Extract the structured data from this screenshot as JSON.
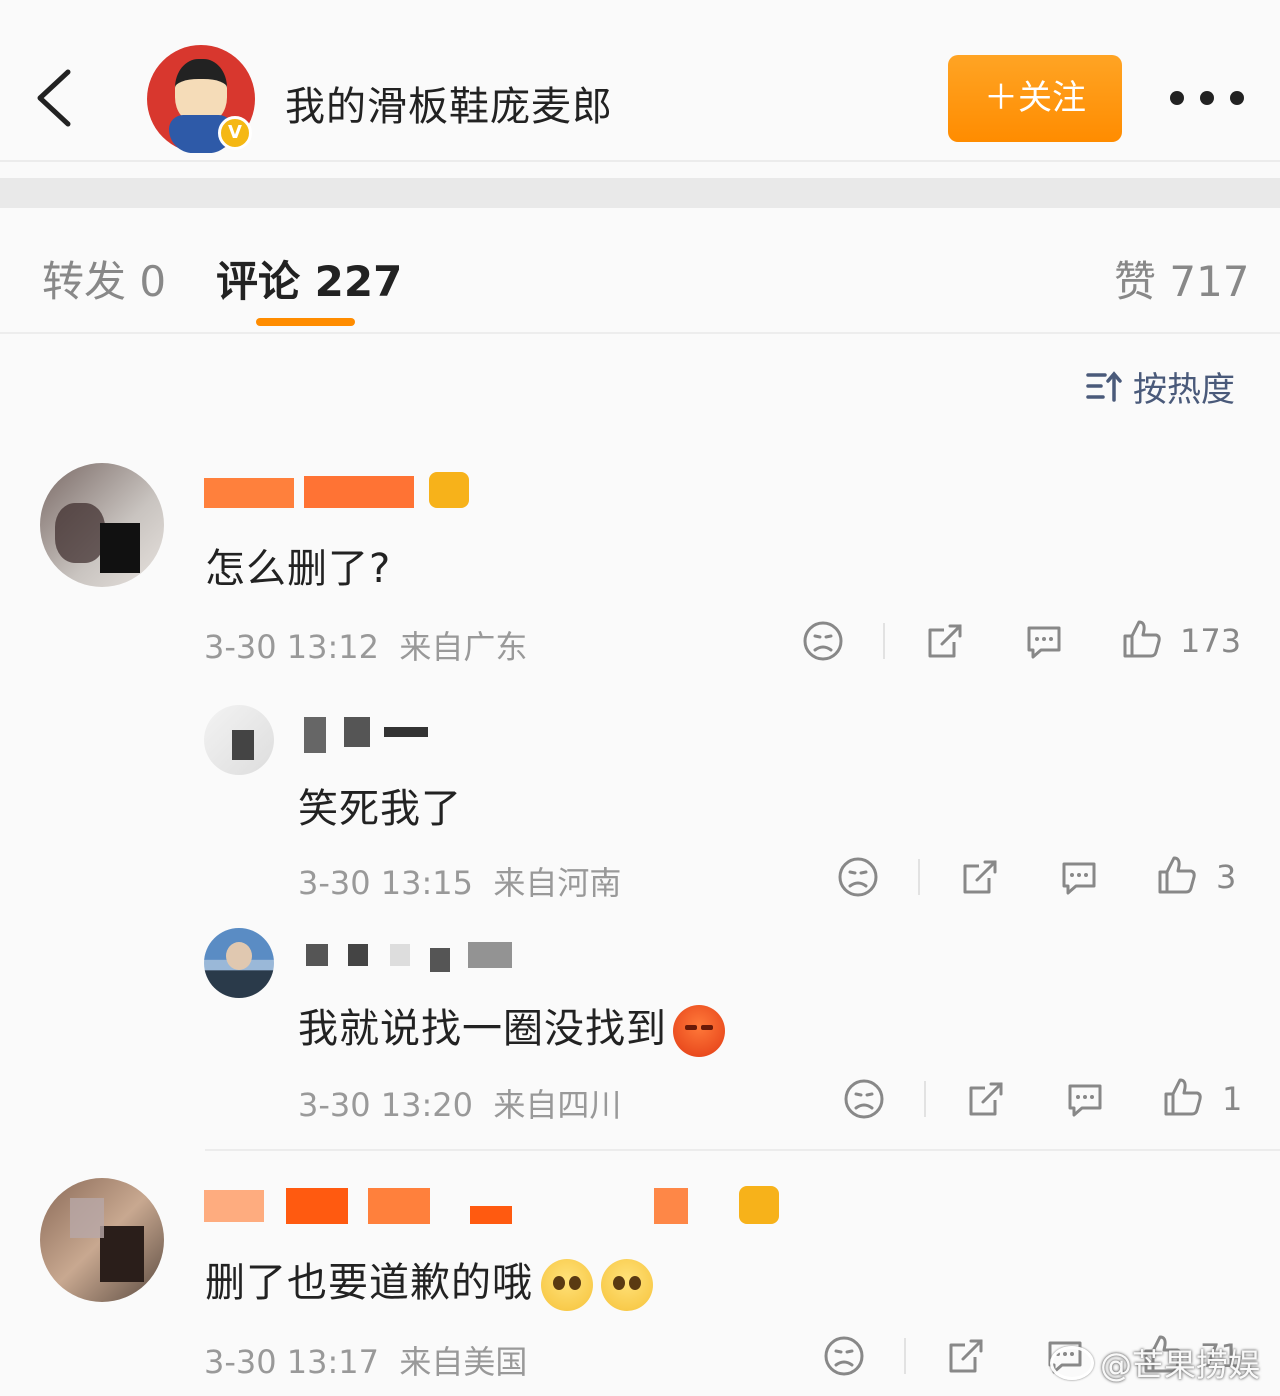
{
  "header": {
    "title": "我的滑板鞋庞麦郎",
    "follow_label": "＋关注",
    "verified_mark": "V"
  },
  "tabs": {
    "reposts": "转发 0",
    "comments": "评论 227",
    "likes": "赞 717"
  },
  "sort": {
    "label": "按热度"
  },
  "comments": [
    {
      "text": "怎么删了?",
      "time": "3-30 13:12",
      "location": "来自广东",
      "likes": "173"
    },
    {
      "text": "笑死我了",
      "time": "3-30 13:15",
      "location": "来自河南",
      "likes": "3"
    },
    {
      "text": "我就说找一圈没找到",
      "time": "3-30 13:20",
      "location": "来自四川",
      "likes": "1"
    },
    {
      "text": "删了也要道歉的哦",
      "time": "3-30 13:17",
      "location": "来自美国",
      "likes": "71"
    }
  ],
  "watermark": {
    "text": "@芒果捞娱"
  },
  "colors": {
    "accent": "#ff8c00",
    "sort": "#4a5a7a",
    "meta": "#999999"
  }
}
